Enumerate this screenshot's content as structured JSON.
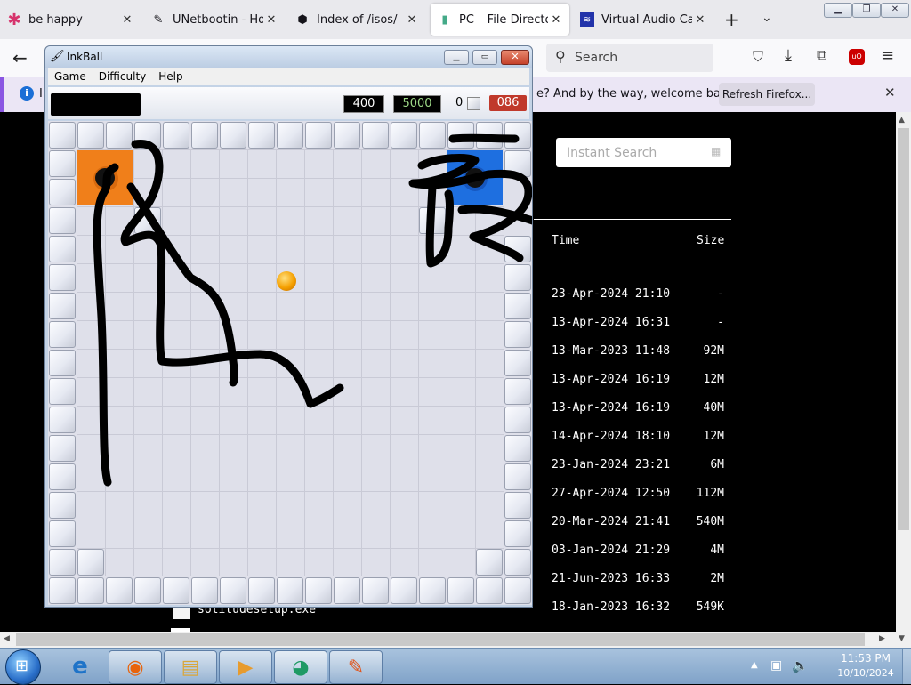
{
  "browser": {
    "tabs": [
      {
        "label": "be happy",
        "icon": "asterisk-icon",
        "active": false
      },
      {
        "label": "UNetbootin - Hom",
        "icon": "pen-icon",
        "active": false
      },
      {
        "label": "Index of /isos/",
        "icon": "cube-icon",
        "active": false
      },
      {
        "label": "PC – File Directory",
        "icon": "document-icon",
        "active": true
      },
      {
        "label": "Virtual Audio Cable",
        "icon": "audio-icon",
        "active": false
      }
    ],
    "new_tab_symbol": "+",
    "search_placeholder": "Search",
    "notification": {
      "text": "e? And by the way, welcome back!",
      "button": "Refresh Firefox...",
      "leading_text": "I"
    }
  },
  "page": {
    "instant_search_placeholder": "Instant Search",
    "columns": {
      "time": "Time",
      "size": "Size"
    },
    "rows": [
      {
        "time": "23-Apr-2024 21:10",
        "size": "-"
      },
      {
        "time": "13-Apr-2024 16:31",
        "size": "-"
      },
      {
        "time": "13-Mar-2023 11:48",
        "size": "92M"
      },
      {
        "time": "13-Apr-2024 16:19",
        "size": "12M"
      },
      {
        "time": "13-Apr-2024 16:19",
        "size": "40M"
      },
      {
        "time": "14-Apr-2024 18:10",
        "size": "12M"
      },
      {
        "time": "23-Jan-2024 23:21",
        "size": "6M"
      },
      {
        "time": "27-Apr-2024 12:50",
        "size": "112M"
      },
      {
        "time": "20-Mar-2024 21:41",
        "size": "540M"
      },
      {
        "time": "03-Jan-2024 21:29",
        "size": "4M"
      },
      {
        "time": "21-Jun-2023 16:33",
        "size": "2M"
      },
      {
        "time": "18-Jan-2023 16:32",
        "size": "549K"
      }
    ],
    "partial_file_name": "solitudesetup.exe"
  },
  "inkball": {
    "title": "InkBall",
    "menu": [
      "Game",
      "Difficulty",
      "Help"
    ],
    "score": "400",
    "high_score": "5000",
    "balls_count": "0",
    "timer": "086",
    "colors": {
      "orange": "#f07f1a",
      "blue": "#1e6fe0",
      "ball": "#f5a000"
    }
  },
  "taskbar": {
    "clock_time": "11:53 PM",
    "clock_date": "10/10/2024",
    "apps": [
      "ie-icon",
      "firefox-icon",
      "explorer-icon",
      "media-player-icon",
      "media-center-icon",
      "inkball-icon"
    ]
  }
}
